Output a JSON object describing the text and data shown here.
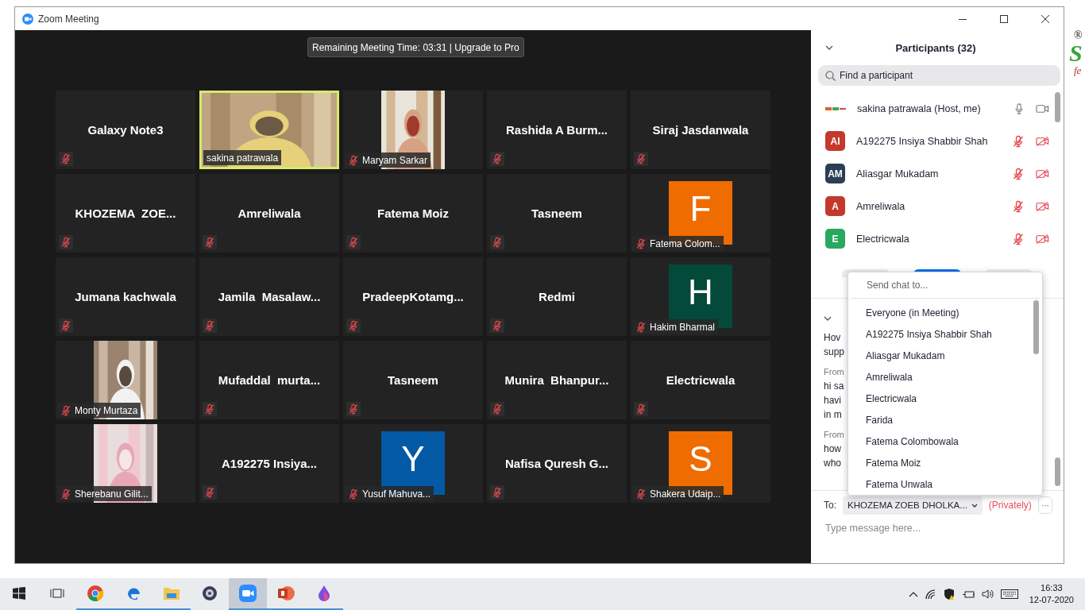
{
  "window": {
    "title": "Zoom Meeting"
  },
  "meeting": {
    "banner": "Remaining Meeting Time: 03:31 | Upgrade to Pro",
    "tiles": [
      {
        "kind": "name",
        "name": "Galaxy Note3",
        "muted": true,
        "active": false
      },
      {
        "kind": "video",
        "name": "sakina patrawala",
        "muted": false,
        "active": true
      },
      {
        "kind": "video_portrait",
        "name": "Maryam Sarkar",
        "muted": true,
        "active": false
      },
      {
        "kind": "name",
        "name": "Rashida A Burm...",
        "muted": true,
        "active": false
      },
      {
        "kind": "name",
        "name": "Siraj Jasdanwala",
        "muted": true,
        "active": false
      },
      {
        "kind": "name",
        "name": "KHOZEMA  ZOE...",
        "muted": true,
        "active": false
      },
      {
        "kind": "name",
        "name": "Amreliwala",
        "muted": true,
        "active": false
      },
      {
        "kind": "name",
        "name": "Fatema Moiz",
        "muted": true,
        "active": false
      },
      {
        "kind": "name",
        "name": "Tasneem",
        "muted": true,
        "active": false
      },
      {
        "kind": "avatar",
        "letter": "F",
        "color": "#ef6c00",
        "name": "Fatema Colom...",
        "muted": true,
        "active": false
      },
      {
        "kind": "name",
        "name": "Jumana kachwala",
        "muted": true,
        "active": false
      },
      {
        "kind": "name",
        "name": "Jamila  Masalaw...",
        "muted": true,
        "active": false
      },
      {
        "kind": "name",
        "name": "PradeepKotamg...",
        "muted": true,
        "active": false
      },
      {
        "kind": "name",
        "name": "Redmi",
        "muted": true,
        "active": false
      },
      {
        "kind": "avatar",
        "letter": "H",
        "color": "#034a3a",
        "name": "Hakim Bharmal",
        "muted": true,
        "active": false
      },
      {
        "kind": "video_portrait",
        "name": "Monty Murtaza",
        "muted": true,
        "active": false
      },
      {
        "kind": "name",
        "name": "Mufaddal  murta...",
        "muted": true,
        "active": false
      },
      {
        "kind": "name",
        "name": "Tasneem",
        "muted": true,
        "active": false
      },
      {
        "kind": "name",
        "name": "Munira  Bhanpur...",
        "muted": true,
        "active": false
      },
      {
        "kind": "name",
        "name": "Electricwala",
        "muted": true,
        "active": false
      },
      {
        "kind": "video_portrait",
        "name": "Sherebanu Gilit...",
        "muted": true,
        "active": false
      },
      {
        "kind": "name",
        "name": "A192275 Insiya...",
        "muted": true,
        "active": false
      },
      {
        "kind": "avatar",
        "letter": "Y",
        "color": "#0359a4",
        "name": "Yusuf Mahuva...",
        "muted": true,
        "active": false
      },
      {
        "kind": "name",
        "name": "Nafisa Quresh G...",
        "muted": true,
        "active": false
      },
      {
        "kind": "avatar",
        "letter": "S",
        "color": "#ef6c00",
        "name": "Shakera Udaip...",
        "muted": true,
        "active": false
      }
    ]
  },
  "participants_panel": {
    "title": "Participants (32)",
    "search": {
      "placeholder": "Find a participant"
    },
    "participants": [
      {
        "kind": "logo",
        "name": "sakina patrawala (Host, me)",
        "muted": false,
        "video_off": false
      },
      {
        "kind": "initials",
        "initials": "AI",
        "color": "#c3392c",
        "name": "A192275 Insiya Shabbir Shah",
        "muted": true,
        "video_off": true
      },
      {
        "kind": "initials",
        "initials": "AM",
        "color": "#2c3e55",
        "name": "Aliasgar Mukadam",
        "muted": true,
        "video_off": true
      },
      {
        "kind": "initials",
        "initials": "A",
        "color": "#c3392c",
        "name": "Amreliwala",
        "muted": true,
        "video_off": true
      },
      {
        "kind": "initials",
        "initials": "E",
        "color": "#28a860",
        "name": "Electricwala",
        "muted": true,
        "video_off": true
      }
    ]
  },
  "chat": {
    "messages": [
      {
        "lines": [
          "Hov",
          "supp"
        ]
      },
      {
        "sender": "From",
        "lines": [
          "hi sa",
          "havi",
          "in m"
        ]
      },
      {
        "sender": "From",
        "lines": [
          "how",
          "who"
        ]
      }
    ],
    "dropdown": {
      "search": {
        "placeholder": "Send chat to..."
      },
      "items": [
        "Everyone (in Meeting)",
        "A192275 Insiya Shabbir Shah",
        "Aliasgar Mukadam",
        "Amreliwala",
        "Electricwala",
        "Farida",
        "Fatema Colombowala",
        "Fatema Moiz",
        "Fatema Unwala"
      ]
    },
    "to_label": "To:",
    "recipient": "KHOZEMA ZOEB DHOLKA...",
    "privately": "(Privately)",
    "more": "···",
    "message": {
      "placeholder": "Type message here..."
    }
  },
  "taskbar": {
    "apps": [
      {
        "kind": "taskview",
        "running": false,
        "selected": false
      },
      {
        "kind": "chrome",
        "running": true,
        "selected": false
      },
      {
        "kind": "edge",
        "running": true,
        "selected": false
      },
      {
        "kind": "explorer",
        "running": true,
        "selected": false
      },
      {
        "kind": "disc",
        "running": false,
        "selected": false
      },
      {
        "kind": "zoom",
        "running": true,
        "selected": true
      },
      {
        "kind": "powerpoint",
        "running": true,
        "selected": false
      },
      {
        "kind": "drop",
        "running": true,
        "selected": false
      }
    ],
    "clock": {
      "time": "16:33",
      "date": "12-07-2020"
    }
  },
  "desktop": {
    "fragments": [
      "®",
      "S",
      "fe"
    ]
  }
}
